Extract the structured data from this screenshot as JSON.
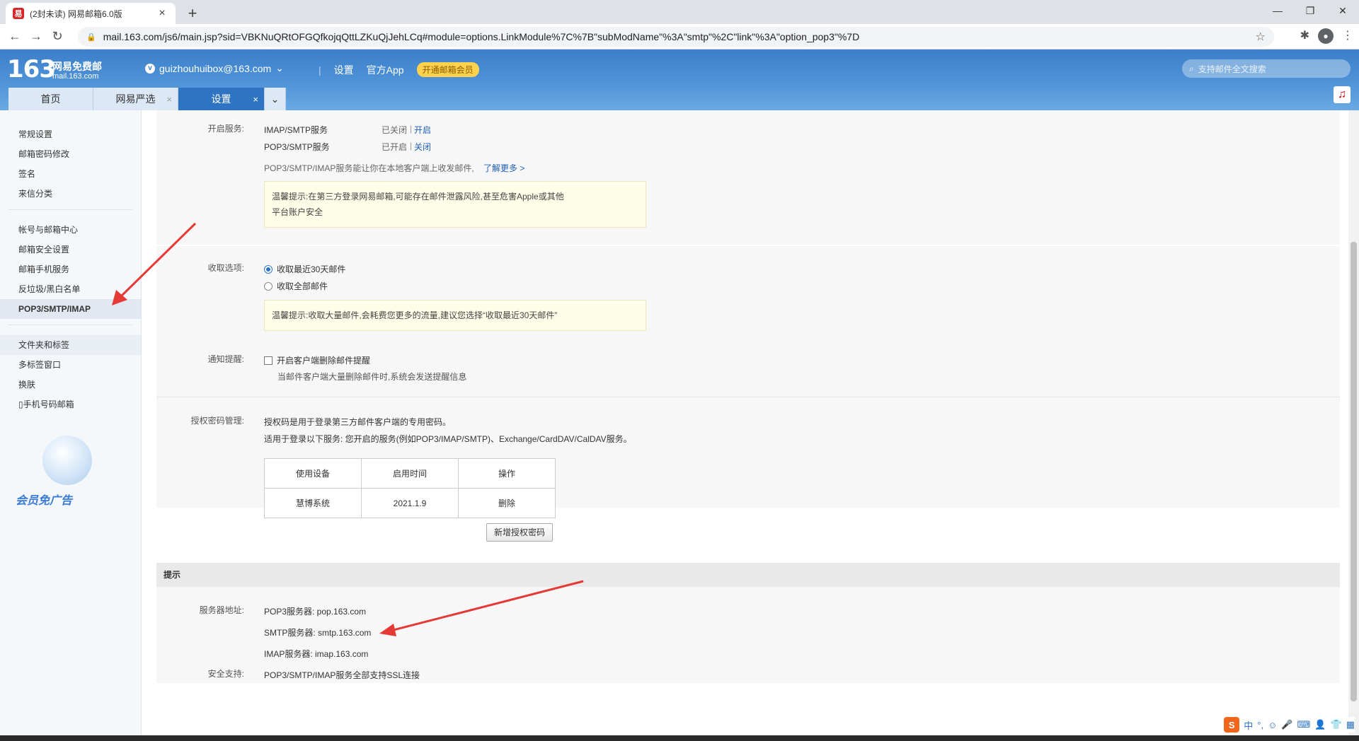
{
  "browser": {
    "tab_title": "(2封未读) 网易邮箱6.0版",
    "url": "mail.163.com/js6/main.jsp?sid=VBKNuQRtOFGQfkojqQttLZKuQjJehLCq#module=options.LinkModule%7C%7B\"subModName\"%3A\"smtp\"%2C\"link\"%3A\"option_pop3\"%7D"
  },
  "header": {
    "logo_num": "163",
    "logo_name": "网易免费邮",
    "logo_domain": "mail.163.com",
    "account": "guizhouhuibox@163.com",
    "link_settings": "设置",
    "link_app": "官方App",
    "vip_label": "开通邮箱会员",
    "search_placeholder": "支持邮件全文搜索"
  },
  "mail_tabs": [
    {
      "label": "首页"
    },
    {
      "label": "网易严选"
    },
    {
      "label": "设置"
    }
  ],
  "sidebar": {
    "group1": [
      "常规设置",
      "邮箱密码修改",
      "签名",
      "来信分类"
    ],
    "group2": [
      "帐号与邮箱中心",
      "邮箱安全设置",
      "邮箱手机服务",
      "反垃圾/黑白名单",
      "POP3/SMTP/IMAP"
    ],
    "group3": [
      "文件夹和标签",
      "多标签窗口",
      "换肤",
      "手机号码邮箱"
    ],
    "ad_text": "会员免广告"
  },
  "services": {
    "label": "开启服务:",
    "imap_name": "IMAP/SMTP服务",
    "imap_status": "已关闭",
    "imap_action": "开启",
    "pop3_name": "POP3/SMTP服务",
    "pop3_status": "已开启",
    "pop3_action": "关闭",
    "desc": "POP3/SMTP/IMAP服务能让你在本地客户端上收发邮件,",
    "learn_more": "了解更多 >",
    "tip_line1": "温馨提示:在第三方登录网易邮箱,可能存在邮件泄露风险,甚至危害Apple或其他",
    "tip_line2": "平台账户安全"
  },
  "receive": {
    "label": "收取选项:",
    "opt1": "收取最近30天邮件",
    "opt2": "收取全部邮件",
    "tip": "温馨提示:收取大量邮件,会耗费您更多的流量,建议您选择“收取最近30天邮件”"
  },
  "notify": {
    "label": "通知提醒:",
    "option": "开启客户端删除邮件提醒",
    "desc": "当邮件客户端大量删除邮件时,系统会发送提醒信息"
  },
  "auth": {
    "label": "授权密码管理:",
    "line1": "授权码是用于登录第三方邮件客户端的专用密码。",
    "line2": "适用于登录以下服务: 您开启的服务(例如POP3/IMAP/SMTP)、Exchange/CardDAV/CalDAV服务。",
    "headers": [
      "使用设备",
      "启用时间",
      "操作"
    ],
    "rows": [
      [
        "慧博系统",
        "2021.1.9",
        "删除"
      ]
    ],
    "new_button": "新增授权密码"
  },
  "hint": {
    "title": "提示",
    "server_label": "服务器地址:",
    "pop3": "POP3服务器: pop.163.com",
    "smtp": "SMTP服务器: smtp.163.com",
    "imap": "IMAP服务器: imap.163.com",
    "security_label": "安全支持:",
    "security": "POP3/SMTP/IMAP服务全部支持SSL连接"
  },
  "ime": {
    "lang": "中"
  },
  "colors": {
    "header_blue": "#4f93d8",
    "active_tab": "#2f74c2",
    "arrow_red": "#e53935",
    "link": "#1f5fb4"
  }
}
